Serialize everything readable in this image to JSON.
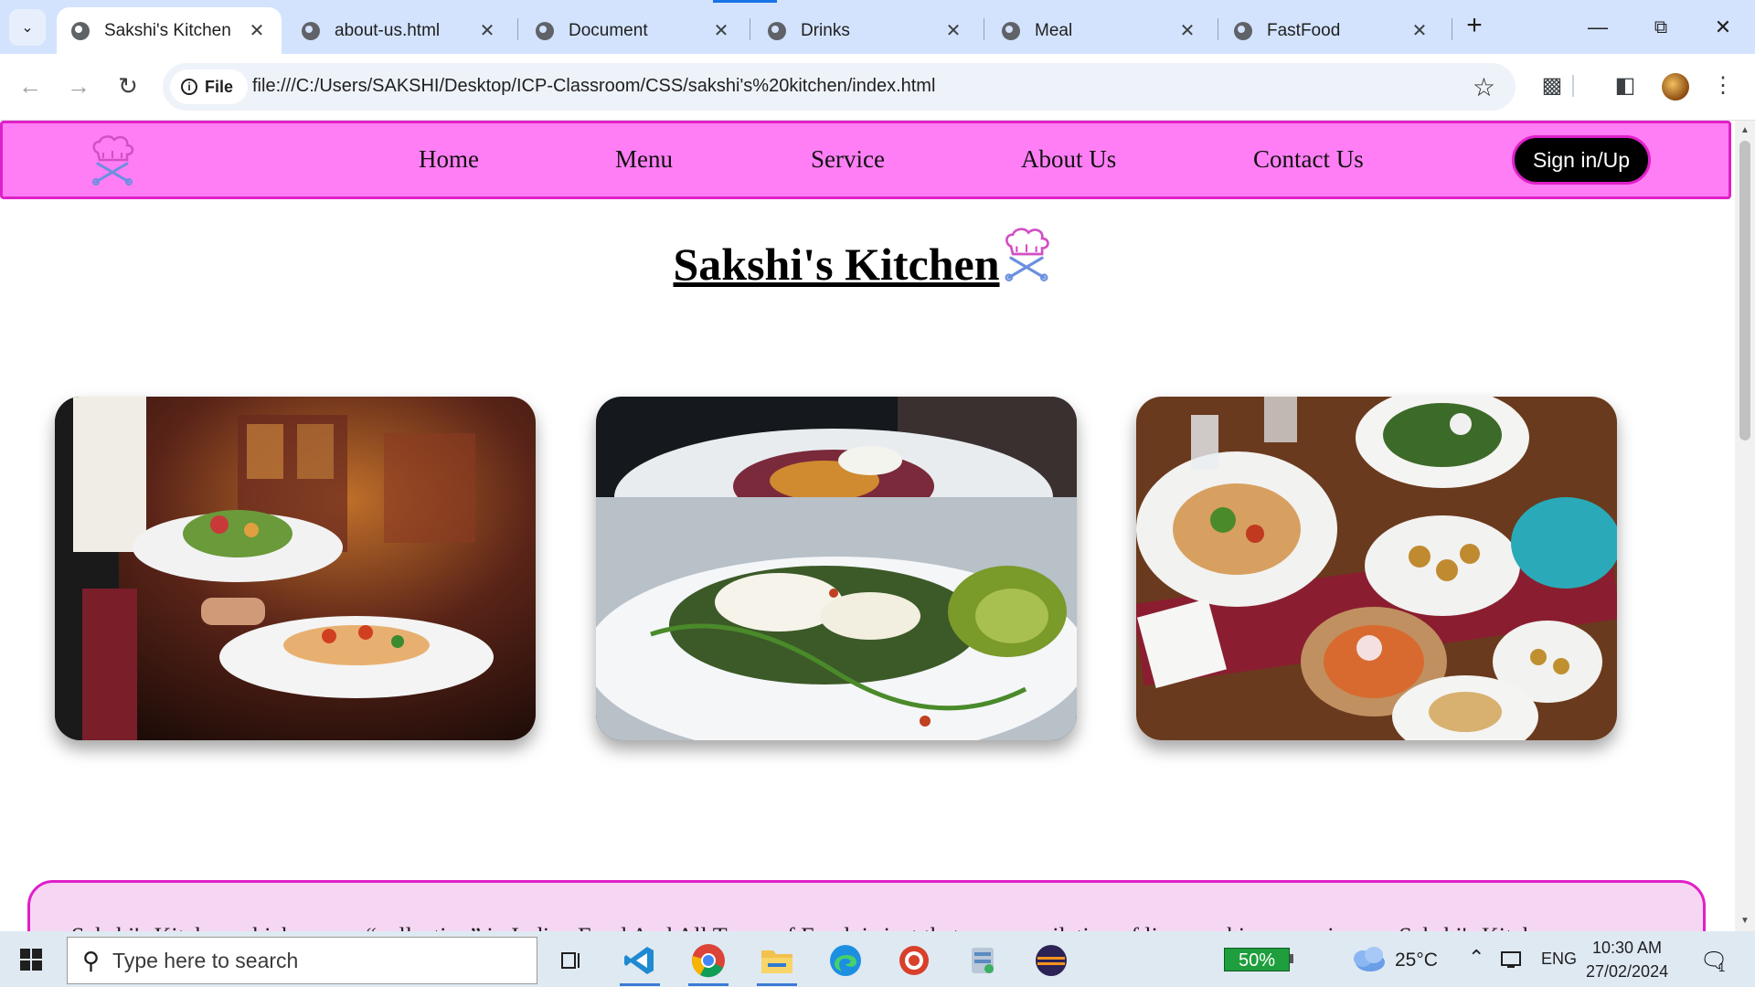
{
  "browser": {
    "tabs": [
      {
        "title": "Sakshi's Kitchen",
        "active": true
      },
      {
        "title": "about-us.html",
        "active": false
      },
      {
        "title": "Document",
        "active": false
      },
      {
        "title": "Drinks",
        "active": false
      },
      {
        "title": "Meal",
        "active": false
      },
      {
        "title": "FastFood",
        "active": false
      }
    ],
    "chip_label": "File",
    "url": "file:///C:/Users/SAKSHI/Desktop/ICP-Classroom/CSS/sakshi's%20kitchen/index.html"
  },
  "site": {
    "nav": {
      "links": [
        "Home",
        "Menu",
        "Service",
        "About Us",
        "Contact Us"
      ],
      "signin_label": "Sign in/Up"
    },
    "title": "Sakshi's Kitchen",
    "photos": [
      {
        "description": "Waiter holding plates of salad and bruschetta"
      },
      {
        "description": "Plate with poached egg, greens and avocado"
      },
      {
        "description": "Table with many dishes on red runner"
      }
    ],
    "about_text_partial": "Sakshi's Kitchen which means “collection” in Indian Food And All Types of Food, is just that – a compilation of lip-smacking experiences. Sakshi's Kitch"
  },
  "taskbar": {
    "search_placeholder": "Type here to search",
    "battery": "50%",
    "temperature": "25°C",
    "language": "ENG",
    "time": "10:30 AM",
    "date": "27/02/2024",
    "notifications": "1"
  }
}
